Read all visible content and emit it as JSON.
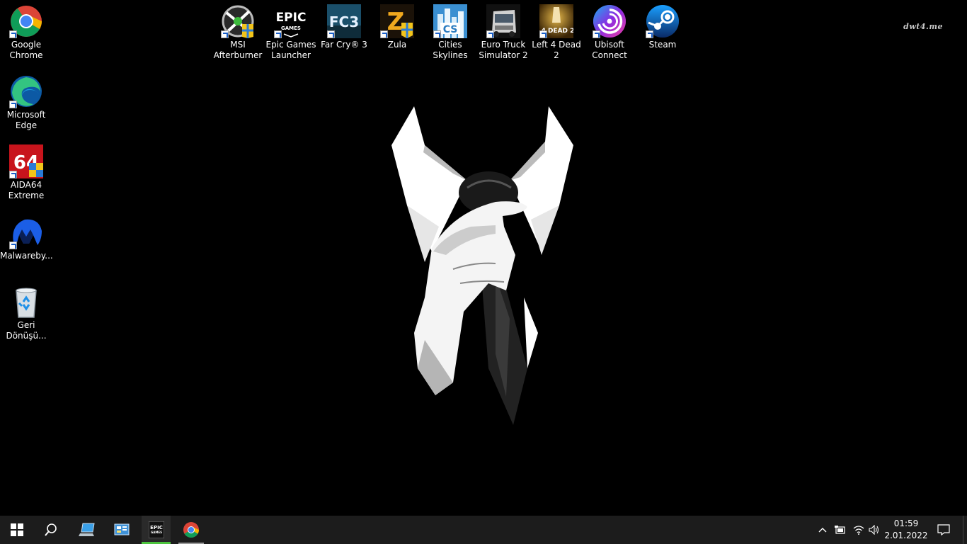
{
  "wallpaper": {
    "watermark": "dwt4.me",
    "background_color": "#000000"
  },
  "desktop_icons_left": [
    {
      "id": "google-chrome",
      "label": "Google Chrome"
    },
    {
      "id": "microsoft-edge",
      "label": "Microsoft Edge"
    },
    {
      "id": "aida64-extreme",
      "label": "AIDA64 Extreme"
    },
    {
      "id": "malwarebytes",
      "label": "Malwareby..."
    },
    {
      "id": "recycle-bin",
      "label": "Geri Dönüşü..."
    }
  ],
  "desktop_icons_top": [
    {
      "id": "msi-afterburner",
      "label": "MSI Afterburner"
    },
    {
      "id": "epic-games-launcher",
      "label": "Epic Games Launcher",
      "logo_text": "EPIC",
      "logo_sub": "GAMES"
    },
    {
      "id": "far-cry-3",
      "label": "Far Cry® 3",
      "logo_text": "FC3"
    },
    {
      "id": "zula",
      "label": "Zula",
      "logo_text": "Z"
    },
    {
      "id": "cities-skylines",
      "label": "Cities Skylines",
      "logo_text": "CS"
    },
    {
      "id": "euro-truck-simulator-2",
      "label": "Euro Truck Simulator 2"
    },
    {
      "id": "left-4-dead-2",
      "label": "Left 4 Dead 2",
      "logo_text": "4 DEAD 2"
    },
    {
      "id": "ubisoft-connect",
      "label": "Ubisoft Connect"
    },
    {
      "id": "steam",
      "label": "Steam"
    }
  ],
  "taskbar": {
    "pinned": [
      {
        "id": "start",
        "icon": "windows-logo-icon"
      },
      {
        "id": "search",
        "icon": "search-icon"
      },
      {
        "id": "this-pc",
        "icon": "computer-icon"
      },
      {
        "id": "control-panel",
        "icon": "control-panel-icon"
      },
      {
        "id": "epic-games",
        "icon": "epic-games-icon",
        "active": true,
        "logo_text": "EPIC",
        "logo_sub": "GAMES"
      },
      {
        "id": "chrome",
        "icon": "chrome-icon",
        "running": true
      }
    ],
    "tray": {
      "icons": [
        "chevron-up-icon",
        "battery-icon",
        "wifi-icon",
        "volume-icon"
      ],
      "time": "01:59",
      "date": "2.01.2022",
      "notification_icon": "notification-icon"
    },
    "accent_color": "#4cc43e"
  }
}
